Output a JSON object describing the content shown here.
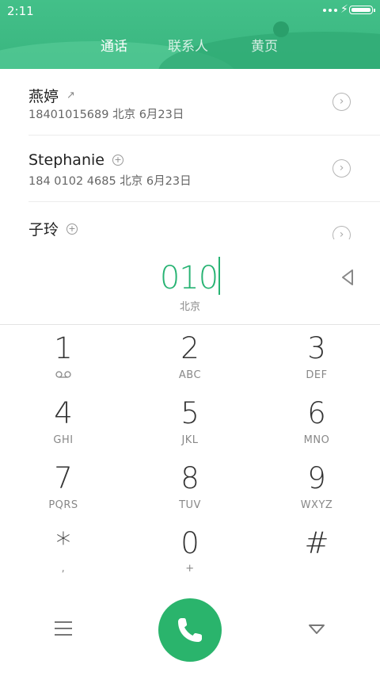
{
  "status_bar": {
    "time": "2:11"
  },
  "tabs": [
    {
      "label": "通话",
      "active": true
    },
    {
      "label": "联系人",
      "active": false
    },
    {
      "label": "黄页",
      "active": false
    }
  ],
  "recents": [
    {
      "name": "燕婷",
      "detail": "18401015689  北京  6月23日",
      "indicator": "outgoing-arrow-icon"
    },
    {
      "name": "Stephanie",
      "detail": "184 0102 4685  北京  6月23日",
      "indicator": "add-contact-icon"
    },
    {
      "name": "子玲",
      "detail": "",
      "indicator": "add-contact-icon"
    }
  ],
  "dialer": {
    "number": "010",
    "region": "北京"
  },
  "keypad": [
    {
      "digit": "1",
      "letters": ""
    },
    {
      "digit": "2",
      "letters": "ABC"
    },
    {
      "digit": "3",
      "letters": "DEF"
    },
    {
      "digit": "4",
      "letters": "GHI"
    },
    {
      "digit": "5",
      "letters": "JKL"
    },
    {
      "digit": "6",
      "letters": "MNO"
    },
    {
      "digit": "7",
      "letters": "PQRS"
    },
    {
      "digit": "8",
      "letters": "TUV"
    },
    {
      "digit": "9",
      "letters": "WXYZ"
    },
    {
      "digit": "*",
      "letters": ","
    },
    {
      "digit": "0",
      "letters": "+"
    },
    {
      "digit": "#",
      "letters": ""
    }
  ],
  "colors": {
    "accent": "#27b373",
    "header": "#3dba82",
    "call_button": "#2ab46c"
  }
}
